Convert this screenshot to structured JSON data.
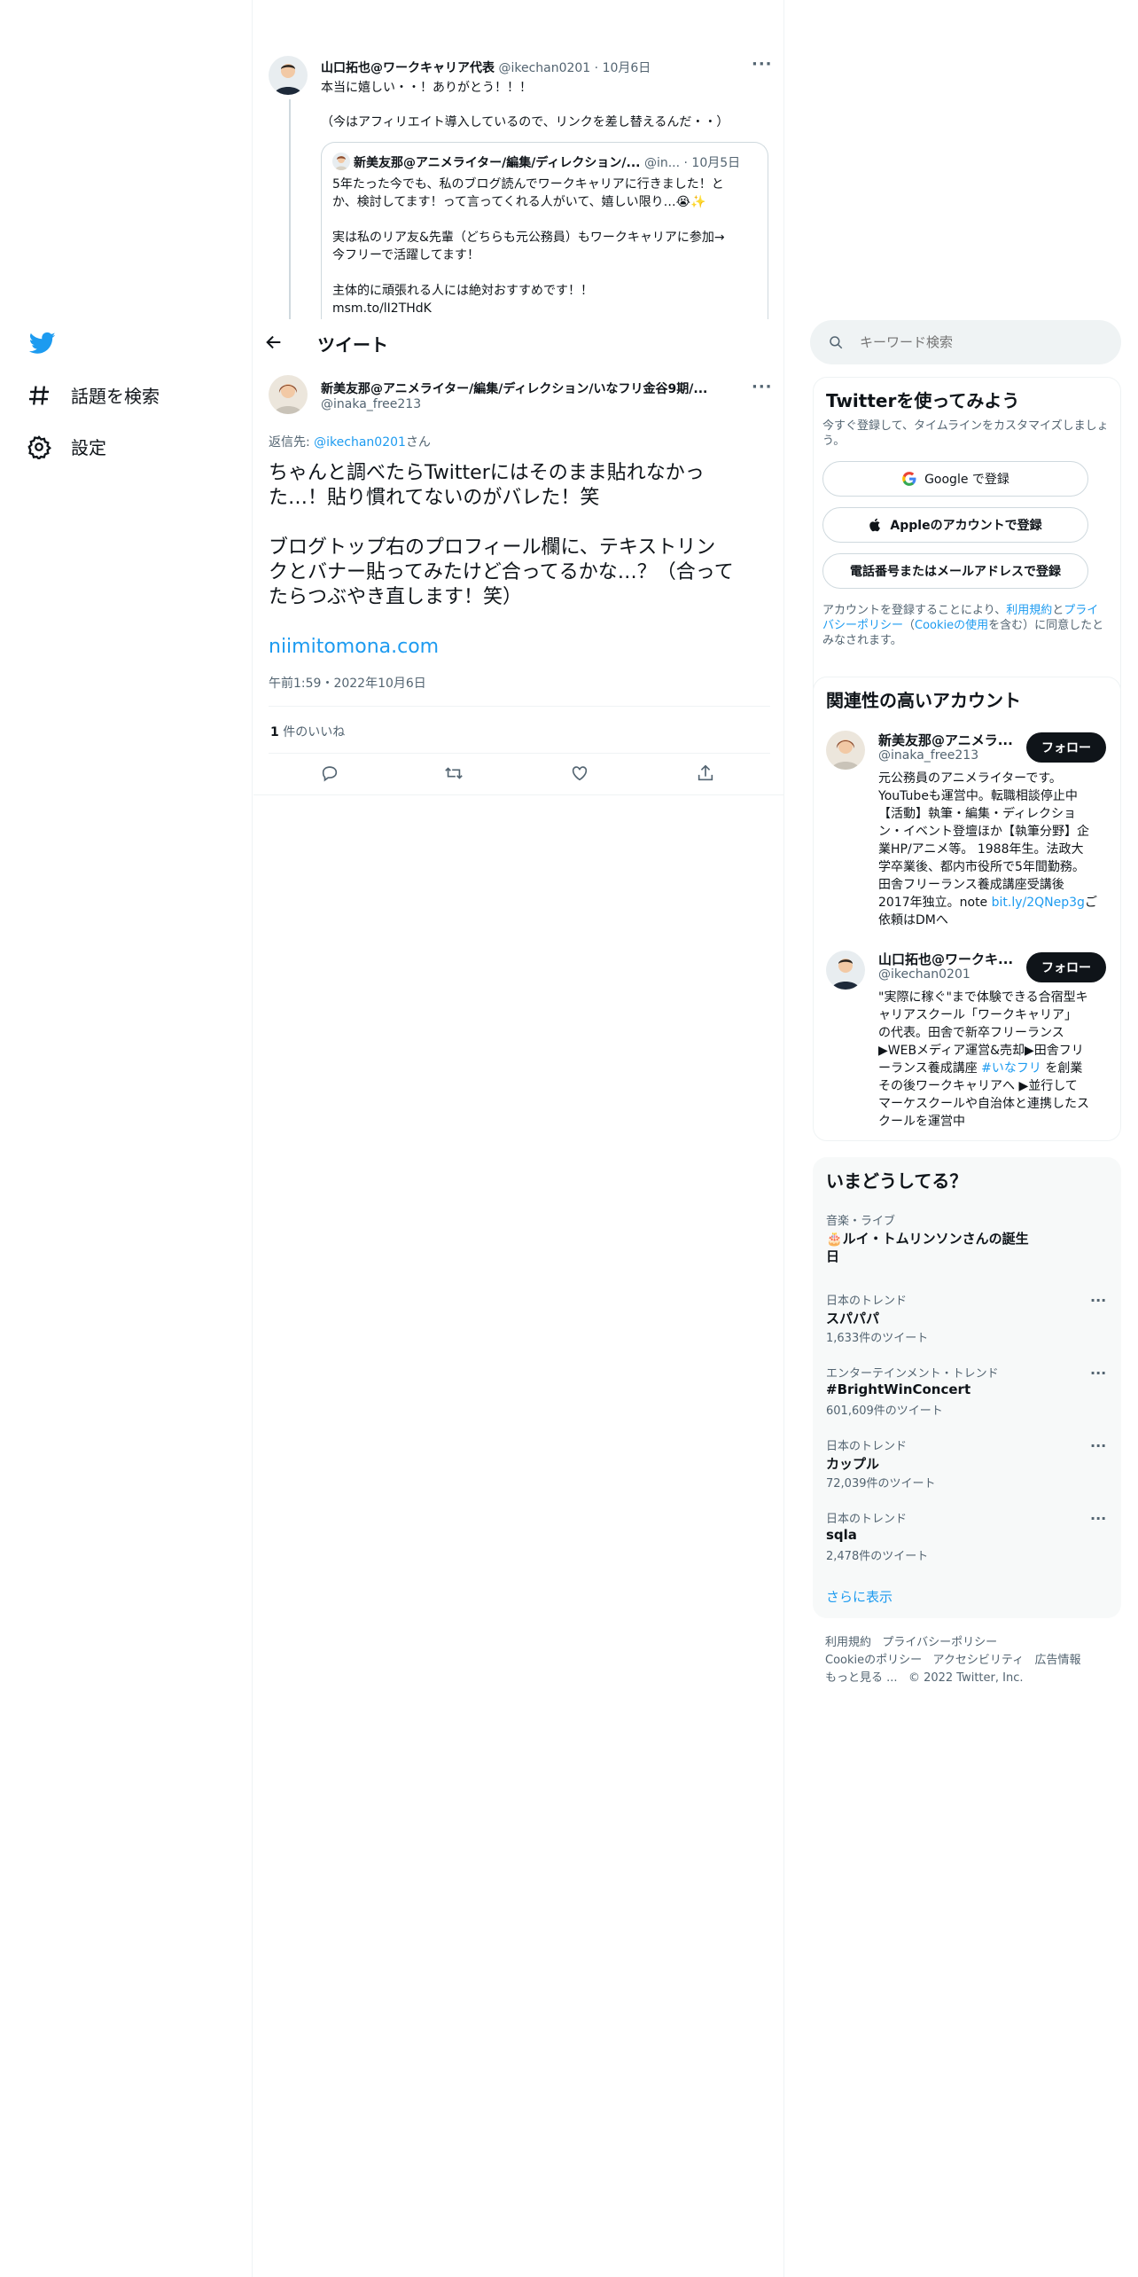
{
  "nav": {
    "explore_label": "話題を検索",
    "settings_label": "設定"
  },
  "header": {
    "title": "ツイート"
  },
  "parent_tweet": {
    "author": "山口拓也@ワークキャリア代表",
    "handle": "@ikechan0201",
    "date": "· 10月6日",
    "line1": "本当に嬉しい・・！ありがとう！！！",
    "line2": "（今はアフィリエイト導入しているので、リンクを差し替えるんだ・・）",
    "quote": {
      "author": "新美友那@アニメライター/編集/ディレクション/...",
      "handle": "@in...",
      "date": "· 10月5日",
      "line1": "5年たった今でも、私のブログ読んでワークキャリアに行きました！と",
      "line2": "か、検討してます！って言ってくれる人がいて、嬉しい限り…😭✨",
      "line3": "実は私のリア友&先輩（どちらも元公務員）もワークキャリアに参加→",
      "line4": "今フリーで活躍してます！",
      "line5": "主体的に頑張れる人には絶対おすすめです！！",
      "link": "msm.to/lI2THdK"
    }
  },
  "main_tweet": {
    "author": "新美友那@アニメライター/編集/ディレクション/いなフリ金谷9期/...",
    "handle": "@inaka_free213",
    "reply_prefix": "返信先: ",
    "reply_to": "@ikechan0201",
    "reply_suffix": "さん",
    "body_line1": "ちゃんと調べたらTwitterにはそのまま貼れなかっ",
    "body_line2": "た…！貼り慣れてないのがバレた！笑",
    "body_line3": "ブログトップ右のプロフィール欄に、テキストリン",
    "body_line4": "クとバナー貼ってみたけど合ってるかな…？（合って",
    "body_line5": "たらつぶやき直します！笑）",
    "link": "niimitomona.com",
    "timestamp": "午前1:59・2022年10月6日",
    "likes_count": "1",
    "likes_label": " 件のいいね"
  },
  "search": {
    "placeholder": "キーワード検索"
  },
  "signup": {
    "title": "Twitterを使ってみよう",
    "subtitle_line1": "今すぐ登録して、タイムラインをカスタマイズしましょ",
    "subtitle_line2": "う。",
    "google_label": "Google で登録",
    "apple_label": "Appleのアカウントで登録",
    "phone_label": "電話番号またはメールアドレスで登録",
    "terms": {
      "t1": "アカウントを登録することにより、",
      "link1": "利用規約",
      "t2": "と",
      "link2": "プライ",
      "link2b": "バシーポリシー",
      "t3": "（",
      "link3": "Cookieの使用",
      "t4": "を含む）に同意したと",
      "t5": "みなされます。"
    }
  },
  "related": {
    "title": "関連性の高いアカウント",
    "follow_label": "フォロー",
    "accounts": [
      {
        "name": "新美友那@アニメラ...",
        "handle": "@inaka_free213",
        "bio": [
          "元公務員のアニメライターです。",
          "YouTubeも運営中。転職相談停止中",
          "【活動】執筆・編集・ディレクショ",
          "ン・イベント登壇ほか【執筆分野】企",
          "業HP/アニメ等。 1988年生。法政大",
          "学卒業後、都内市役所で5年間勤務。",
          "田舎フリーランス養成講座受講後",
          "2017年独立。note "
        ],
        "bio_link": "bit.ly/2QNep3g",
        "bio_tail": "ご",
        "bio_last": "依頼はDMへ"
      },
      {
        "name": "山口拓也@ワークキ...",
        "handle": "@ikechan0201",
        "bio": [
          "\"実際に稼ぐ\"まで体験できる合宿型キ",
          "ャリアスクール「ワークキャリア」",
          "の代表。田舎で新卒フリーランス",
          "▶WEBメディア運営&売却▶田舎フリ",
          "ーランス養成講座 "
        ],
        "bio_link": "#いなフリ",
        "bio_tail": " を創業",
        "bio_rest": [
          "その後ワークキャリアへ ▶並行して",
          "マーケスクールや自治体と連携したス",
          "クールを運営中"
        ]
      }
    ]
  },
  "trends": {
    "title": "いまどうしてる？",
    "items": [
      {
        "category": "音楽・ライブ",
        "name_line1": "🎂ルイ・トムリンソンさんの誕生",
        "name_line2": "日",
        "count": ""
      },
      {
        "category": "日本のトレンド",
        "name_line1": "スパパパ",
        "name_line2": "",
        "count": "1,633件のツイート"
      },
      {
        "category": "エンターテインメント・トレンド",
        "name_line1": "#BrightWinConcert",
        "name_line2": "",
        "count": "601,609件のツイート"
      },
      {
        "category": "日本のトレンド",
        "name_line1": "カップル",
        "name_line2": "",
        "count": "72,039件のツイート"
      },
      {
        "category": "日本のトレンド",
        "name_line1": "sqla",
        "name_line2": "",
        "count": "2,478件のツイート"
      }
    ],
    "show_more": "さらに表示"
  },
  "footer": {
    "terms": "利用規約",
    "privacy": "プライバシーポリシー",
    "cookie": "Cookieのポリシー",
    "accessibility": "アクセシビリティ",
    "ads": "広告情報",
    "more": "もっと見る ...",
    "copyright": "© 2022 Twitter, Inc."
  },
  "colors": {
    "accent": "#1d9bf0",
    "text": "#0f1419",
    "muted": "#536471",
    "border": "#eff3f4"
  },
  "icons": [
    "twitter-logo-icon",
    "hashtag-icon",
    "gear-icon",
    "back-arrow-icon",
    "more-icon",
    "search-icon",
    "google-icon",
    "apple-icon",
    "reply-icon",
    "retweet-icon",
    "like-icon",
    "share-icon"
  ]
}
